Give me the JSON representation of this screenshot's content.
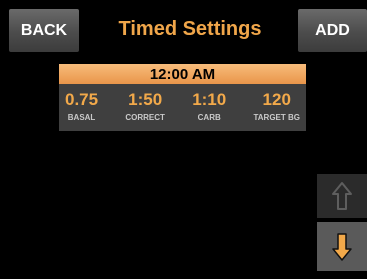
{
  "header": {
    "back_label": "BACK",
    "title": "Timed Settings",
    "add_label": "ADD"
  },
  "setting": {
    "time": "12:00 AM",
    "values": [
      {
        "value": "0.75",
        "label": "BASAL"
      },
      {
        "value": "1:50",
        "label": "CORRECT"
      },
      {
        "value": "1:10",
        "label": "CARB"
      },
      {
        "value": "120",
        "label": "TARGET BG"
      }
    ]
  },
  "icons": {
    "up": "arrow-up-icon",
    "down": "arrow-down-icon"
  },
  "colors": {
    "accent": "#f0a64a",
    "background": "#000000"
  }
}
